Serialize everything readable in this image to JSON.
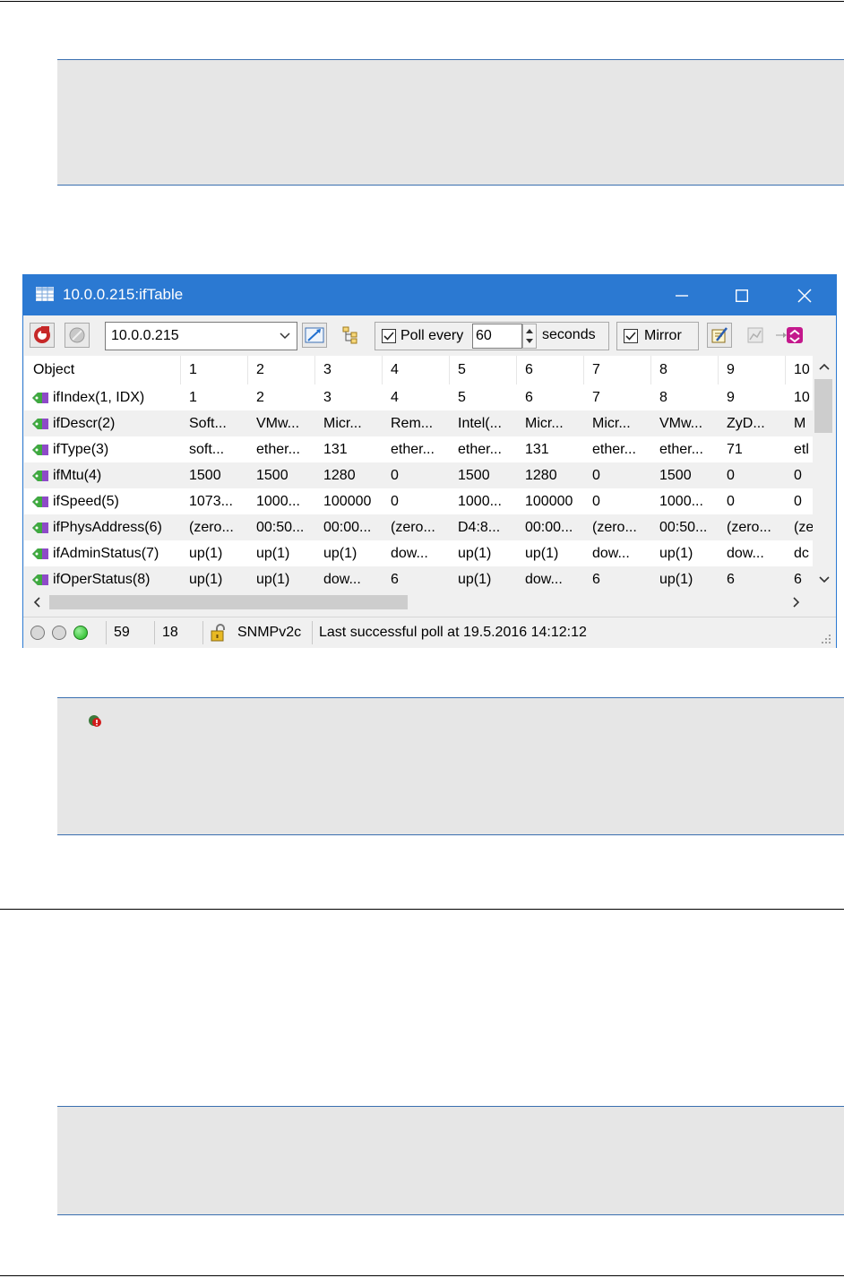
{
  "window": {
    "title": "10.0.0.215:ifTable",
    "host": "10.0.0.215",
    "poll_label": "Poll every",
    "poll_interval": "60",
    "poll_units": "seconds",
    "mirror_label": "Mirror"
  },
  "grid": {
    "header": [
      "Object",
      "1",
      "2",
      "3",
      "4",
      "5",
      "6",
      "7",
      "8",
      "9",
      "10"
    ],
    "rows": [
      {
        "object": "ifIndex(1, IDX)",
        "cells": [
          "1",
          "2",
          "3",
          "4",
          "5",
          "6",
          "7",
          "8",
          "9",
          "10"
        ]
      },
      {
        "object": "ifDescr(2)",
        "cells": [
          "Soft...",
          "VMw...",
          "Micr...",
          "Rem...",
          "Intel(...",
          "Micr...",
          "Micr...",
          "VMw...",
          "ZyD...",
          "M"
        ]
      },
      {
        "object": "ifType(3)",
        "cells": [
          "soft...",
          "ether...",
          "131",
          "ether...",
          "ether...",
          "131",
          "ether...",
          "ether...",
          "71",
          "etl"
        ]
      },
      {
        "object": "ifMtu(4)",
        "cells": [
          "1500",
          "1500",
          "1280",
          "0",
          "1500",
          "1280",
          "0",
          "1500",
          "0",
          "0"
        ]
      },
      {
        "object": "ifSpeed(5)",
        "cells": [
          "1073...",
          "1000...",
          "100000",
          "0",
          "1000...",
          "100000",
          "0",
          "1000...",
          "0",
          "0"
        ]
      },
      {
        "object": "ifPhysAddress(6)",
        "cells": [
          "(zero...",
          "00:50...",
          "00:00...",
          "(zero...",
          "D4:8...",
          "00:00...",
          "(zero...",
          "00:50...",
          "(zero...",
          "(ze"
        ]
      },
      {
        "object": "ifAdminStatus(7)",
        "cells": [
          "up(1)",
          "up(1)",
          "up(1)",
          "dow...",
          "up(1)",
          "up(1)",
          "dow...",
          "up(1)",
          "dow...",
          "dc"
        ]
      },
      {
        "object": "ifOperStatus(8)",
        "cells": [
          "up(1)",
          "up(1)",
          "dow...",
          "6",
          "up(1)",
          "dow...",
          "6",
          "up(1)",
          "6",
          "6"
        ]
      }
    ]
  },
  "status": {
    "count_a": "59",
    "count_b": "18",
    "protocol": "SNMPv2c",
    "message": "Last successful poll at 19.5.2016 14:12:12"
  },
  "colors": {
    "titlebar": "#2b79d2",
    "note_border": "#3a6fb0",
    "note_bg": "#e6e6e6"
  }
}
